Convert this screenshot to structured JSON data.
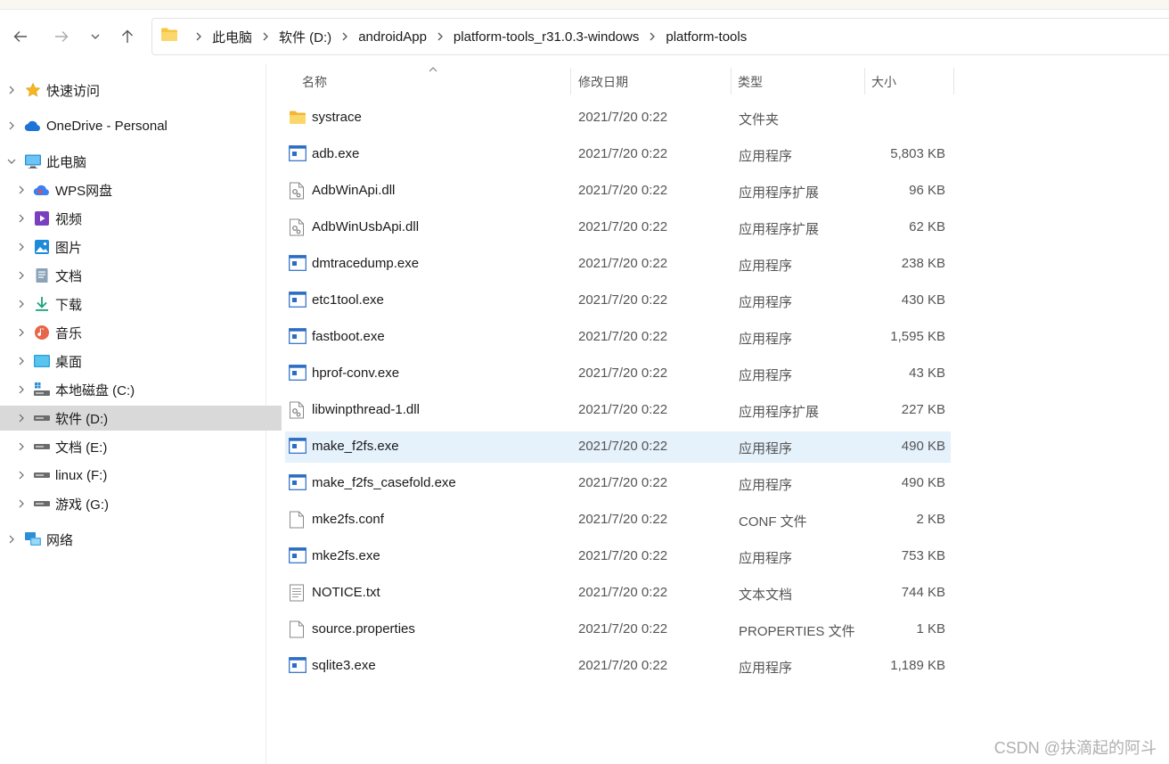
{
  "breadcrumb": [
    "此电脑",
    "软件 (D:)",
    "androidApp",
    "platform-tools_r31.0.3-windows",
    "platform-tools"
  ],
  "sidebar": {
    "items": [
      {
        "label": "快速访问",
        "icon": "star-icon"
      },
      {
        "label": "OneDrive - Personal",
        "icon": "cloud-icon"
      },
      {
        "label": "此电脑",
        "icon": "monitor-icon"
      },
      {
        "label": "WPS网盘",
        "icon": "wps-cloud-icon"
      },
      {
        "label": "视频",
        "icon": "video-icon"
      },
      {
        "label": "图片",
        "icon": "picture-icon"
      },
      {
        "label": "文档",
        "icon": "document-icon"
      },
      {
        "label": "下载",
        "icon": "download-icon"
      },
      {
        "label": "音乐",
        "icon": "music-icon"
      },
      {
        "label": "桌面",
        "icon": "desktop-icon"
      },
      {
        "label": "本地磁盘 (C:)",
        "icon": "system-drive-icon"
      },
      {
        "label": "软件 (D:)",
        "icon": "drive-icon"
      },
      {
        "label": "文档 (E:)",
        "icon": "drive-icon"
      },
      {
        "label": "linux (F:)",
        "icon": "drive-icon"
      },
      {
        "label": "游戏 (G:)",
        "icon": "drive-icon"
      },
      {
        "label": "网络",
        "icon": "network-icon"
      }
    ]
  },
  "columns": {
    "name": "名称",
    "date": "修改日期",
    "type": "类型",
    "size": "大小"
  },
  "files": [
    {
      "name": "systrace",
      "date": "2021/7/20 0:22",
      "type": "文件夹",
      "size": "",
      "icon": "folder-icon"
    },
    {
      "name": "adb.exe",
      "date": "2021/7/20 0:22",
      "type": "应用程序",
      "size": "5,803 KB",
      "icon": "exe-icon"
    },
    {
      "name": "AdbWinApi.dll",
      "date": "2021/7/20 0:22",
      "type": "应用程序扩展",
      "size": "96 KB",
      "icon": "dll-icon"
    },
    {
      "name": "AdbWinUsbApi.dll",
      "date": "2021/7/20 0:22",
      "type": "应用程序扩展",
      "size": "62 KB",
      "icon": "dll-icon"
    },
    {
      "name": "dmtracedump.exe",
      "date": "2021/7/20 0:22",
      "type": "应用程序",
      "size": "238 KB",
      "icon": "exe-icon"
    },
    {
      "name": "etc1tool.exe",
      "date": "2021/7/20 0:22",
      "type": "应用程序",
      "size": "430 KB",
      "icon": "exe-icon"
    },
    {
      "name": "fastboot.exe",
      "date": "2021/7/20 0:22",
      "type": "应用程序",
      "size": "1,595 KB",
      "icon": "exe-icon"
    },
    {
      "name": "hprof-conv.exe",
      "date": "2021/7/20 0:22",
      "type": "应用程序",
      "size": "43 KB",
      "icon": "exe-icon"
    },
    {
      "name": "libwinpthread-1.dll",
      "date": "2021/7/20 0:22",
      "type": "应用程序扩展",
      "size": "227 KB",
      "icon": "dll-icon"
    },
    {
      "name": "make_f2fs.exe",
      "date": "2021/7/20 0:22",
      "type": "应用程序",
      "size": "490 KB",
      "icon": "exe-icon"
    },
    {
      "name": "make_f2fs_casefold.exe",
      "date": "2021/7/20 0:22",
      "type": "应用程序",
      "size": "490 KB",
      "icon": "exe-icon"
    },
    {
      "name": "mke2fs.conf",
      "date": "2021/7/20 0:22",
      "type": "CONF 文件",
      "size": "2 KB",
      "icon": "blank-file-icon"
    },
    {
      "name": "mke2fs.exe",
      "date": "2021/7/20 0:22",
      "type": "应用程序",
      "size": "753 KB",
      "icon": "exe-icon"
    },
    {
      "name": "NOTICE.txt",
      "date": "2021/7/20 0:22",
      "type": "文本文档",
      "size": "744 KB",
      "icon": "text-file-icon"
    },
    {
      "name": "source.properties",
      "date": "2021/7/20 0:22",
      "type": "PROPERTIES 文件",
      "size": "1 KB",
      "icon": "blank-file-icon"
    },
    {
      "name": "sqlite3.exe",
      "date": "2021/7/20 0:22",
      "type": "应用程序",
      "size": "1,189 KB",
      "icon": "exe-icon"
    }
  ],
  "watermark": "CSDN @扶滴起的阿斗",
  "colors": {
    "selection": "#e5f1fb",
    "sidebar_selected": "#d9d9d9",
    "folder": "#f8c542",
    "exe_blue": "#2b6cc4"
  }
}
